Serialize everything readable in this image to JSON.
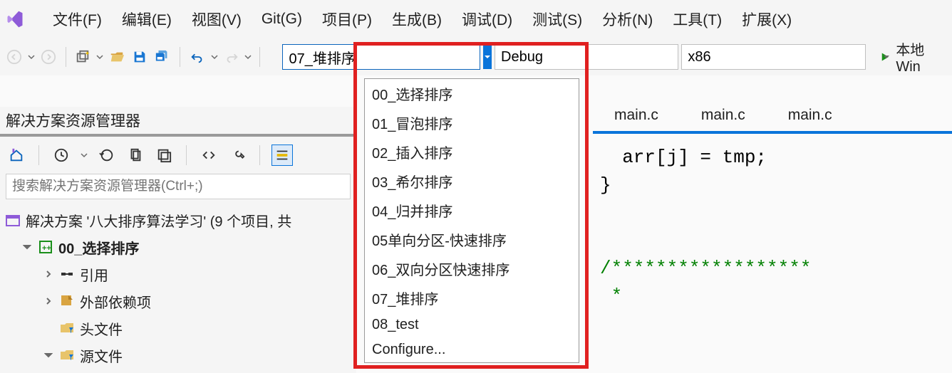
{
  "menubar": {
    "items": [
      "文件(F)",
      "编辑(E)",
      "视图(V)",
      "Git(G)",
      "项目(P)",
      "生成(B)",
      "调试(D)",
      "测试(S)",
      "分析(N)",
      "工具(T)",
      "扩展(X)"
    ]
  },
  "toolbar": {
    "startup_combo": "07_堆排序",
    "config_combo": "Debug",
    "platform_combo": "x86",
    "run_label": "本地 Win"
  },
  "startup_dropdown": {
    "items": [
      "00_选择排序",
      "01_冒泡排序",
      "02_插入排序",
      "03_希尔排序",
      "04_归并排序",
      "05单向分区-快速排序",
      "06_双向分区快速排序",
      "07_堆排序",
      "08_test",
      "Configure..."
    ]
  },
  "tabs": [
    "main.c",
    "main.c",
    "main.c"
  ],
  "code": {
    "line1_a": "  arr[j] = tmp;",
    "line2": "}",
    "line3_empty": "",
    "line4": "/******************",
    "line5": " *"
  },
  "solution_explorer": {
    "title": "解决方案资源管理器",
    "search_placeholder": "搜索解决方案资源管理器(Ctrl+;)",
    "root": "解决方案 '八大排序算法学习' (9 个项目, 共",
    "proj": "00_选择排序",
    "ref": "引用",
    "ext": "外部依赖项",
    "hdr": "头文件",
    "src": "源文件"
  }
}
